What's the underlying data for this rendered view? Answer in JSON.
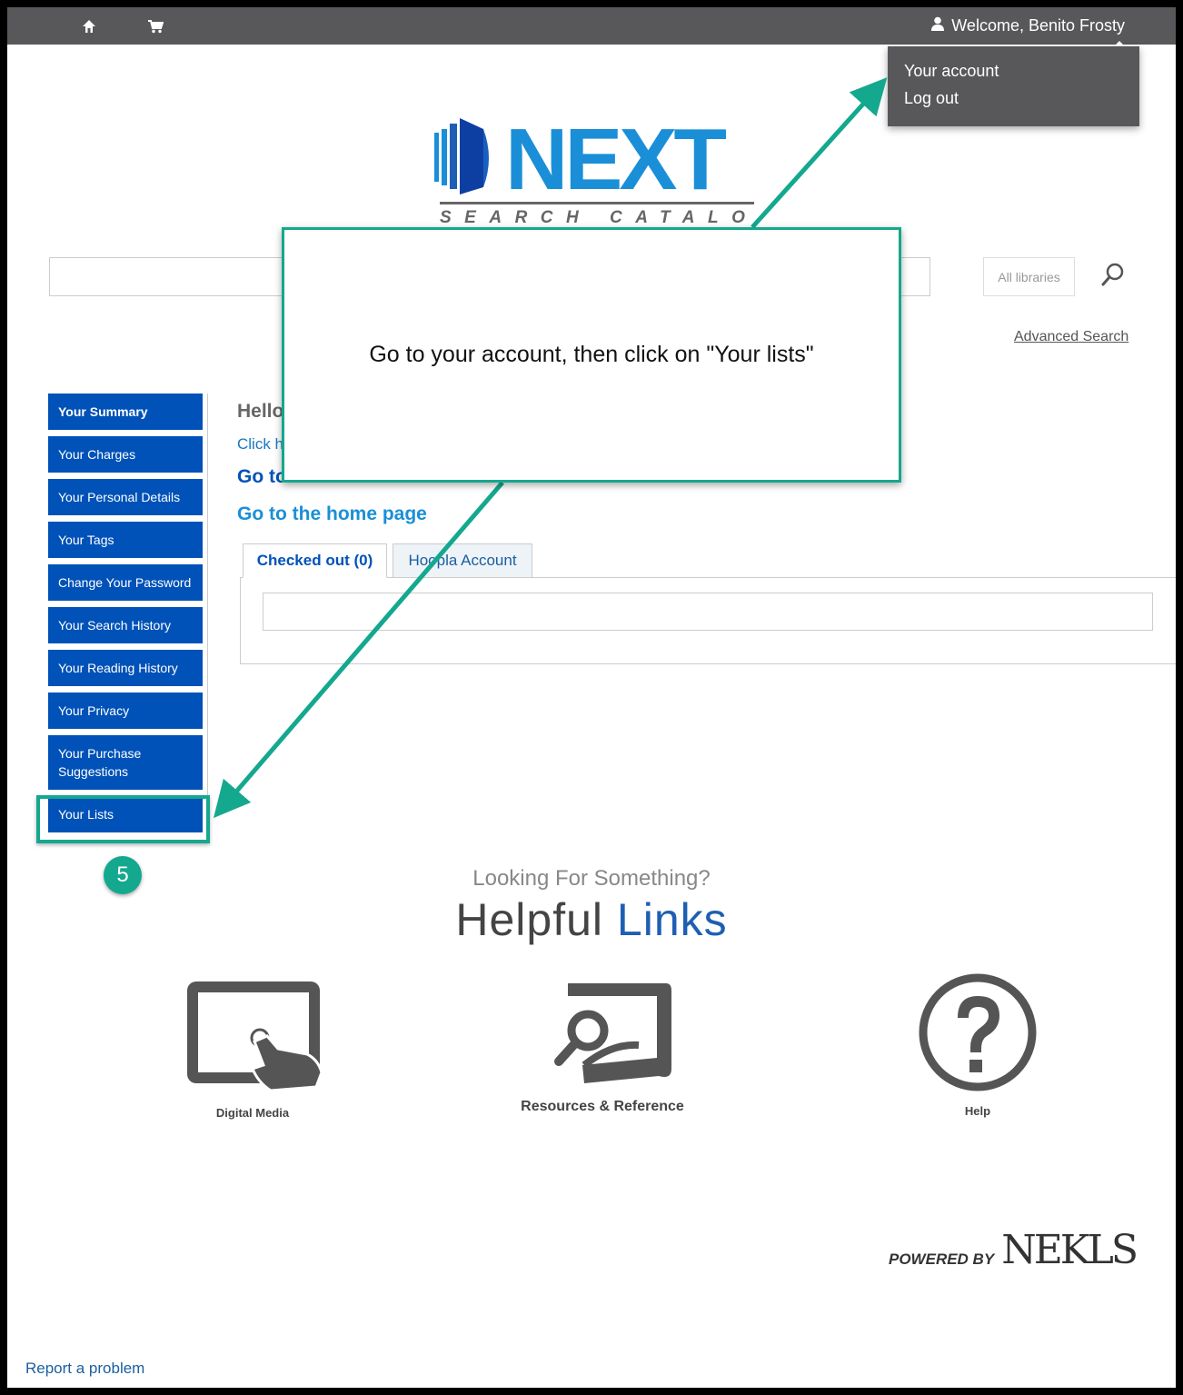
{
  "topbar": {
    "welcome": "Welcome, Benito Frosty",
    "account_menu": [
      "Your account",
      "Log out"
    ]
  },
  "logo": {
    "title": "NEXT",
    "subtitle": "SEARCH CATALOG"
  },
  "search": {
    "query": "",
    "library_select": "All libraries",
    "advanced_link": "Advanced Search"
  },
  "sidebar": {
    "items": [
      {
        "label": "Your Summary"
      },
      {
        "label": "Your Charges"
      },
      {
        "label": "Your Personal Details"
      },
      {
        "label": "Your Tags"
      },
      {
        "label": "Change Your Password"
      },
      {
        "label": "Your Search History"
      },
      {
        "label": "Your Reading History"
      },
      {
        "label": "Your Privacy"
      },
      {
        "label": "Your Purchase Suggestions"
      },
      {
        "label": "Your Lists"
      }
    ]
  },
  "main": {
    "hello": "Hello",
    "click_here": "Click h",
    "goto_top": "Go to",
    "goto_home": "Go to the home page",
    "tabs": [
      {
        "label": "Checked out (0)"
      },
      {
        "label": "Hoopla Account"
      }
    ]
  },
  "callout": {
    "text": "Go to your account, then click on \"Your lists\"",
    "step": "5"
  },
  "helpful": {
    "looking": "Looking For Something?",
    "title_part1": "Helpful",
    "title_part2": "Links",
    "links": [
      {
        "label": "Digital Media",
        "icon": "tablet-touch-icon"
      },
      {
        "label": "Resources & Reference",
        "icon": "magnify-document-icon"
      },
      {
        "label": "Help",
        "icon": "question-circle-icon"
      }
    ]
  },
  "footer": {
    "powered_by": "POWERED BY",
    "brand": "NEKLS",
    "report": "Report a problem"
  },
  "colors": {
    "topbar": "#58585a",
    "sidebar_blue": "#0052b8",
    "callout_teal": "#14a88f",
    "logo_light_blue": "#1a8fd8",
    "logo_dark_blue": "#1e5fb3"
  }
}
